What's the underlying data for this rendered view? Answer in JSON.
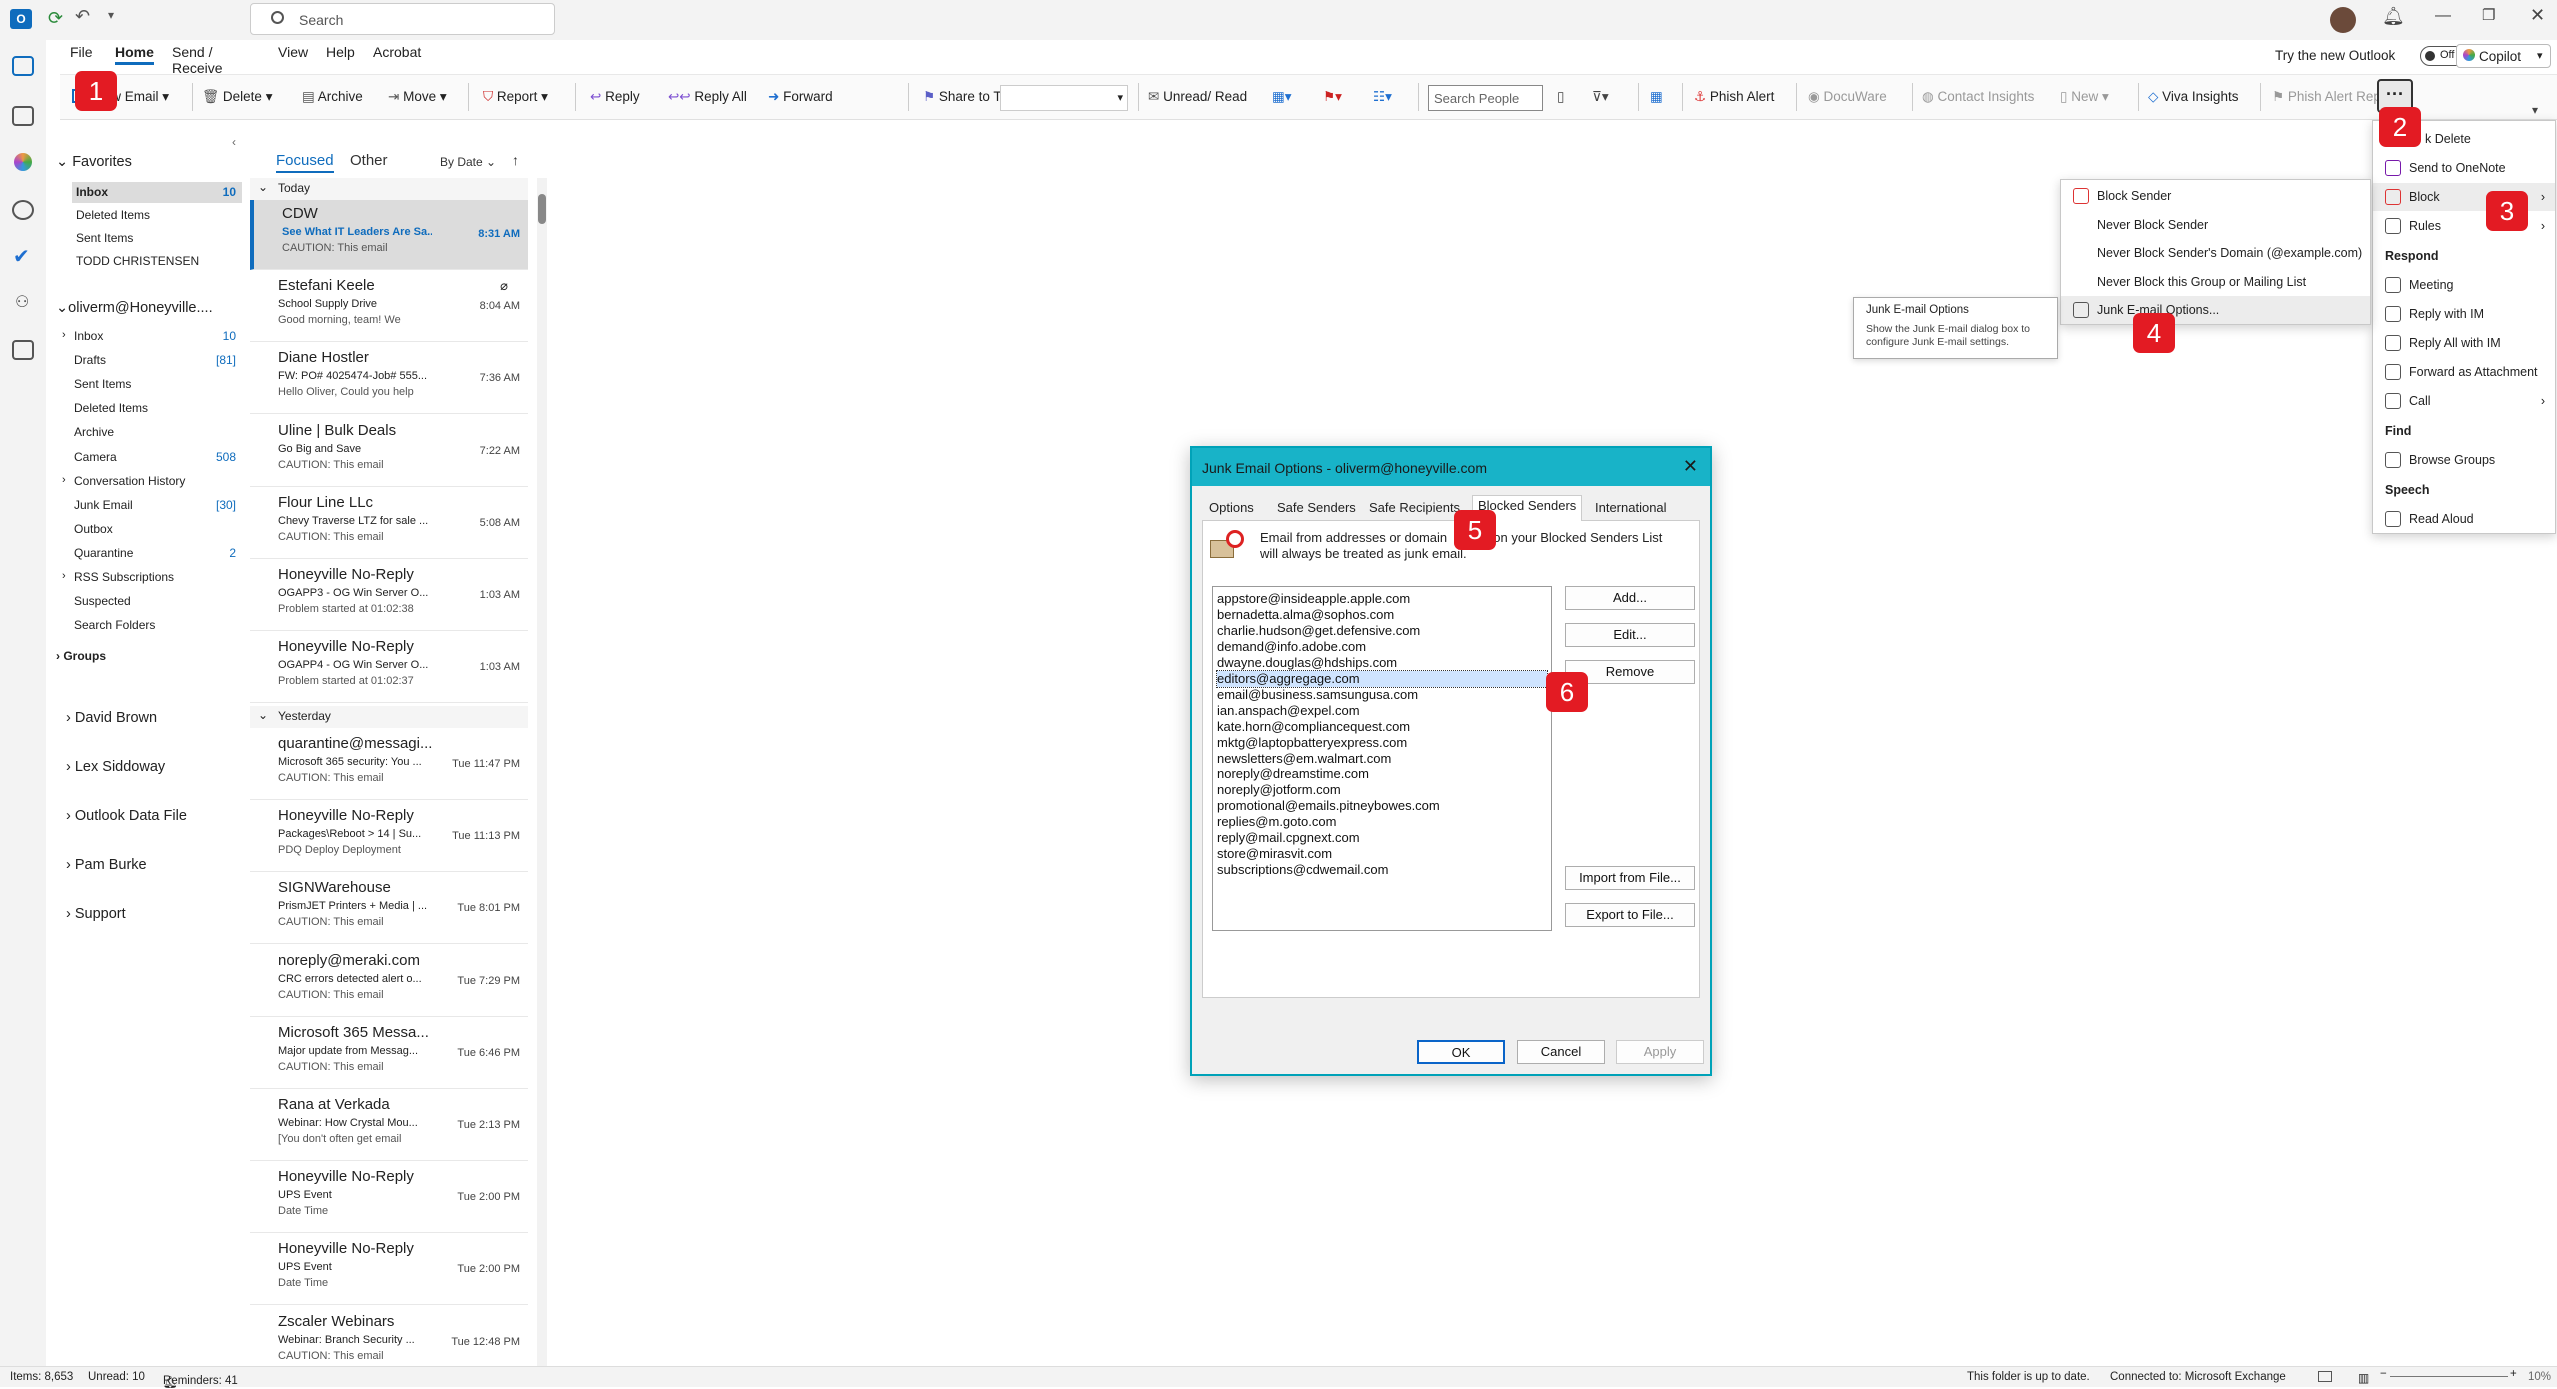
{
  "window": {
    "search_placeholder": "Search",
    "try_new_outlook": "Try the new Outlook",
    "toggle_state": "Off",
    "copilot_label": "Copilot"
  },
  "menu_tabs": [
    "File",
    "Home",
    "Send / Receive",
    "View",
    "Help",
    "Acrobat"
  ],
  "ribbon": {
    "new_email": "New Email",
    "delete": "Delete",
    "archive": "Archive",
    "move": "Move",
    "report": "Report",
    "reply": "Reply",
    "reply_all": "Reply All",
    "forward": "Forward",
    "share_to_teams": "Share to Teams",
    "unread_read": "Unread/ Read",
    "search_people": "Search People",
    "phish_alert": "Phish Alert",
    "docuware": "DocuWare",
    "contact_insights": "Contact Insights",
    "new": "New",
    "viva_insights": "Viva Insights",
    "phish_alert_report": "Phish Alert Report",
    "more": "···"
  },
  "folders": {
    "favorites": "Favorites",
    "fav_items": [
      {
        "label": "Inbox",
        "count": "10",
        "bold": true
      },
      {
        "label": "Deleted Items",
        "count": ""
      },
      {
        "label": "Sent Items",
        "count": ""
      },
      {
        "label": "TODD CHRISTENSEN",
        "count": ""
      }
    ],
    "account": "oliverm@Honeyville....",
    "acct_items": [
      {
        "label": "Inbox",
        "count": "10",
        "arrow": true
      },
      {
        "label": "Drafts",
        "count": "[81]"
      },
      {
        "label": "Sent Items",
        "count": ""
      },
      {
        "label": "Deleted Items",
        "count": ""
      },
      {
        "label": "Archive",
        "count": ""
      },
      {
        "label": "Camera",
        "count": "508"
      },
      {
        "label": "Conversation History",
        "count": "",
        "arrow": true
      },
      {
        "label": "Junk Email",
        "count": "[30]"
      },
      {
        "label": "Outbox",
        "count": ""
      },
      {
        "label": "Quarantine",
        "count": "2"
      },
      {
        "label": "RSS Subscriptions",
        "count": "",
        "arrow": true
      },
      {
        "label": "Suspected",
        "count": ""
      },
      {
        "label": "Search Folders",
        "count": ""
      }
    ],
    "groups": "Groups",
    "other_accounts": [
      "David Brown",
      "Lex Siddoway",
      "Outlook Data File",
      "Pam Burke",
      "Support"
    ]
  },
  "maillist": {
    "tab_focused": "Focused",
    "tab_other": "Other",
    "sort": "By Date",
    "group_today": "Today",
    "group_yesterday": "Yesterday",
    "today": [
      {
        "sender": "CDW",
        "subject": "See What IT Leaders Are Sa...",
        "time": "8:31 AM",
        "preview": "CAUTION: This email"
      },
      {
        "sender": "Estefani Keele",
        "subject": "School Supply Drive",
        "time": "8:04 AM",
        "preview": "Good morning, team!  We"
      },
      {
        "sender": "Diane Hostler",
        "subject": "FW: PO# 4025474-Job# 555...",
        "time": "7:36 AM",
        "preview": "Hello Oliver,  Could you help"
      },
      {
        "sender": "Uline | Bulk Deals",
        "subject": "Go Big and Save",
        "time": "7:22 AM",
        "preview": "CAUTION: This email"
      },
      {
        "sender": "Flour Line LLc",
        "subject": "Chevy Traverse LTZ for sale ...",
        "time": "5:08 AM",
        "preview": "CAUTION: This email"
      },
      {
        "sender": "Honeyville No-Reply",
        "subject": "OGAPP3 - OG Win Server O...",
        "time": "1:03 AM",
        "preview": "Problem started at 01:02:38"
      },
      {
        "sender": "Honeyville No-Reply",
        "subject": "OGAPP4 - OG Win Server O...",
        "time": "1:03 AM",
        "preview": "Problem started at 01:02:37"
      }
    ],
    "yesterday": [
      {
        "sender": "quarantine@messagi...",
        "subject": "Microsoft 365 security: You ...",
        "time": "Tue 11:47 PM",
        "preview": "CAUTION: This email"
      },
      {
        "sender": "Honeyville No-Reply",
        "subject": "Packages\\Reboot > 14 | Su...",
        "time": "Tue 11:13 PM",
        "preview": "PDQ Deploy Deployment"
      },
      {
        "sender": "SIGNWarehouse",
        "subject": "PrismJET Printers + Media | ...",
        "time": "Tue 8:01 PM",
        "preview": "CAUTION: This email"
      },
      {
        "sender": "noreply@meraki.com",
        "subject": "CRC errors detected alert o...",
        "time": "Tue 7:29 PM",
        "preview": "CAUTION: This email"
      },
      {
        "sender": "Microsoft 365 Messa...",
        "subject": "Major update from Messag...",
        "time": "Tue 6:46 PM",
        "preview": "CAUTION: This email"
      },
      {
        "sender": "Rana at Verkada",
        "subject": "Webinar: How Crystal Mou...",
        "time": "Tue 2:13 PM",
        "preview": "[You don't often get email"
      },
      {
        "sender": "Honeyville No-Reply",
        "subject": "UPS Event",
        "time": "Tue 2:00 PM",
        "preview": "Date                 Time"
      },
      {
        "sender": "Honeyville No-Reply",
        "subject": "UPS Event",
        "time": "Tue 2:00 PM",
        "preview": "Date                 Time"
      },
      {
        "sender": "Zscaler Webinars",
        "subject": "Webinar: Branch Security ...",
        "time": "Tue 12:48 PM",
        "preview": "CAUTION: This email"
      }
    ]
  },
  "more_menu": {
    "items": [
      {
        "type": "item",
        "label": "Ignore/Delete"
      },
      {
        "type": "item",
        "label": "Send to OneNote"
      },
      {
        "type": "item",
        "label": "Block",
        "sub": true
      },
      {
        "type": "item",
        "label": "Rules",
        "sub": true
      },
      {
        "type": "head",
        "label": "Respond"
      },
      {
        "type": "item",
        "label": "Meeting"
      },
      {
        "type": "item",
        "label": "Reply with IM"
      },
      {
        "type": "item",
        "label": "Reply All with IM"
      },
      {
        "type": "item",
        "label": "Forward as Attachment"
      },
      {
        "type": "item",
        "label": "Call",
        "sub": true
      },
      {
        "type": "head",
        "label": "Find"
      },
      {
        "type": "item",
        "label": "Browse Groups"
      },
      {
        "type": "head",
        "label": "Speech"
      },
      {
        "type": "item",
        "label": "Read Aloud"
      }
    ]
  },
  "more_menu_first_visible": "k Delete",
  "block_menu": [
    "Block Sender",
    "Never Block Sender",
    "Never Block Sender's Domain (@example.com)",
    "Never Block this Group or Mailing List",
    "Junk E-mail Options..."
  ],
  "tooltip": {
    "title": "Junk E-mail Options",
    "body": "Show the Junk E-mail dialog box to configure Junk E-mail settings."
  },
  "dialog": {
    "title": "Junk Email Options - oliverm@honeyville.com",
    "tabs": [
      "Options",
      "Safe Senders",
      "Safe Recipients",
      "Blocked Senders",
      "International"
    ],
    "description_1": "Email from addresses or domain",
    "description_1b": "s on your Blocked Senders List",
    "description_2": "will always be treated as junk email.",
    "addresses": [
      "appstore@insideapple.apple.com",
      "bernadetta.alma@sophos.com",
      "charlie.hudson@get.defensive.com",
      "demand@info.adobe.com",
      "dwayne.douglas@hdships.com",
      "editors@aggregage.com",
      "email@business.samsungusa.com",
      "ian.anspach@expel.com",
      "kate.horn@compliancequest.com",
      "mktg@laptopbatteryexpress.com",
      "newsletters@em.walmart.com",
      "noreply@dreamstime.com",
      "noreply@jotform.com",
      "promotional@emails.pitneybowes.com",
      "replies@m.goto.com",
      "reply@mail.cpgnext.com",
      "store@mirasvit.com",
      "subscriptions@cdwemail.com"
    ],
    "selected_address": "editors@aggregage.com",
    "btn_add": "Add...",
    "btn_edit": "Edit...",
    "btn_remove": "Remove",
    "btn_import": "Import from File...",
    "btn_export": "Export to File...",
    "btn_ok": "OK",
    "btn_cancel": "Cancel",
    "btn_apply": "Apply"
  },
  "badges": [
    "1",
    "2",
    "3",
    "4",
    "5",
    "6"
  ],
  "status": {
    "items": "Items: 8,653",
    "unread": "Unread: 10",
    "reminders": "Reminders: 41",
    "uptodate": "This folder is up to date.",
    "connected": "Connected to: Microsoft Exchange",
    "zoom": "10%"
  },
  "colors": {
    "accent": "#0f6cbd",
    "badge": "#e31b23",
    "dialog_title": "#18b3c8"
  }
}
